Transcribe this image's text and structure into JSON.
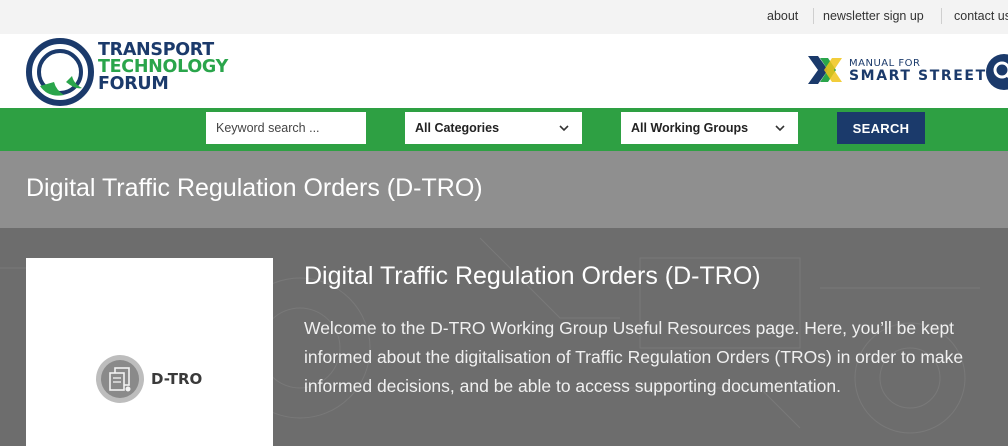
{
  "topbar": {
    "links": [
      "about",
      "newsletter sign up",
      "contact us"
    ]
  },
  "header": {
    "logo": {
      "line1": "TRANSPORT",
      "line2": "TECHNOLOGY",
      "line3": "FORUM"
    },
    "partner": {
      "line1": "MANUAL FOR",
      "line2": "SMART STREETS"
    },
    "icons": {
      "logo": "ttf-q-logo-icon",
      "partner": "manual-for-smart-streets-x-icon",
      "search": "search-icon"
    }
  },
  "search": {
    "keyword_placeholder": "Keyword search ...",
    "category_selected": "All Categories",
    "group_selected": "All Working Groups",
    "button_label": "SEARCH"
  },
  "page": {
    "title": "Digital Traffic Regulation Orders (D-TRO)"
  },
  "hero": {
    "card_label": "D-TRO",
    "card_icon": "document-network-icon",
    "heading": "Digital Traffic Regulation Orders (D-TRO)",
    "body": "Welcome to the D-TRO Working Group Useful Resources page. Here, you’ll be kept informed about the digitalisation of Traffic Regulation Orders (TROs) in order to make informed decisions, and be able to access supporting documentation."
  },
  "colors": {
    "brand_green": "#2ea043",
    "brand_navy": "#1b3a6b",
    "title_band": "#8f8f8f",
    "hero_bg": "#6d6d6d"
  }
}
